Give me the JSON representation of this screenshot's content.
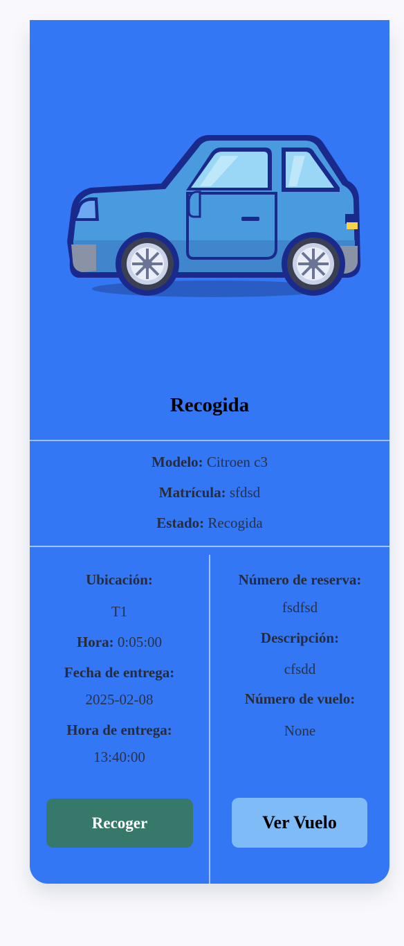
{
  "card": {
    "image": "car-illustration",
    "title": "Recogida"
  },
  "details": {
    "modelo_label": "Modelo:",
    "modelo_value": "Citroen c3",
    "matricula_label": "Matrícula:",
    "matricula_value": "sfdsd",
    "estado_label": "Estado:",
    "estado_value": "Recogida"
  },
  "left_col": {
    "ubicacion_label": "Ubicación:",
    "ubicacion_value": "T1",
    "hora_label": "Hora:",
    "hora_value": "0:05:00",
    "fecha_entrega_label": "Fecha de entrega:",
    "fecha_entrega_value": "2025-02-08",
    "hora_entrega_label": "Hora de entrega:",
    "hora_entrega_value": "13:40:00"
  },
  "right_col": {
    "reserva_label": "Número de reserva:",
    "reserva_value": "fsdfsd",
    "descripcion_label": "Descripción:",
    "descripcion_value": "cfsdd",
    "vuelo_label": "Número de vuelo:",
    "vuelo_value": "None"
  },
  "actions": {
    "recoger_label": "Recoger",
    "ver_vuelo_label": "Ver Vuelo"
  },
  "colors": {
    "card_bg": "#3477f5",
    "recoger_bg": "#367869",
    "ver_vuelo_bg": "#7fbbf7"
  }
}
